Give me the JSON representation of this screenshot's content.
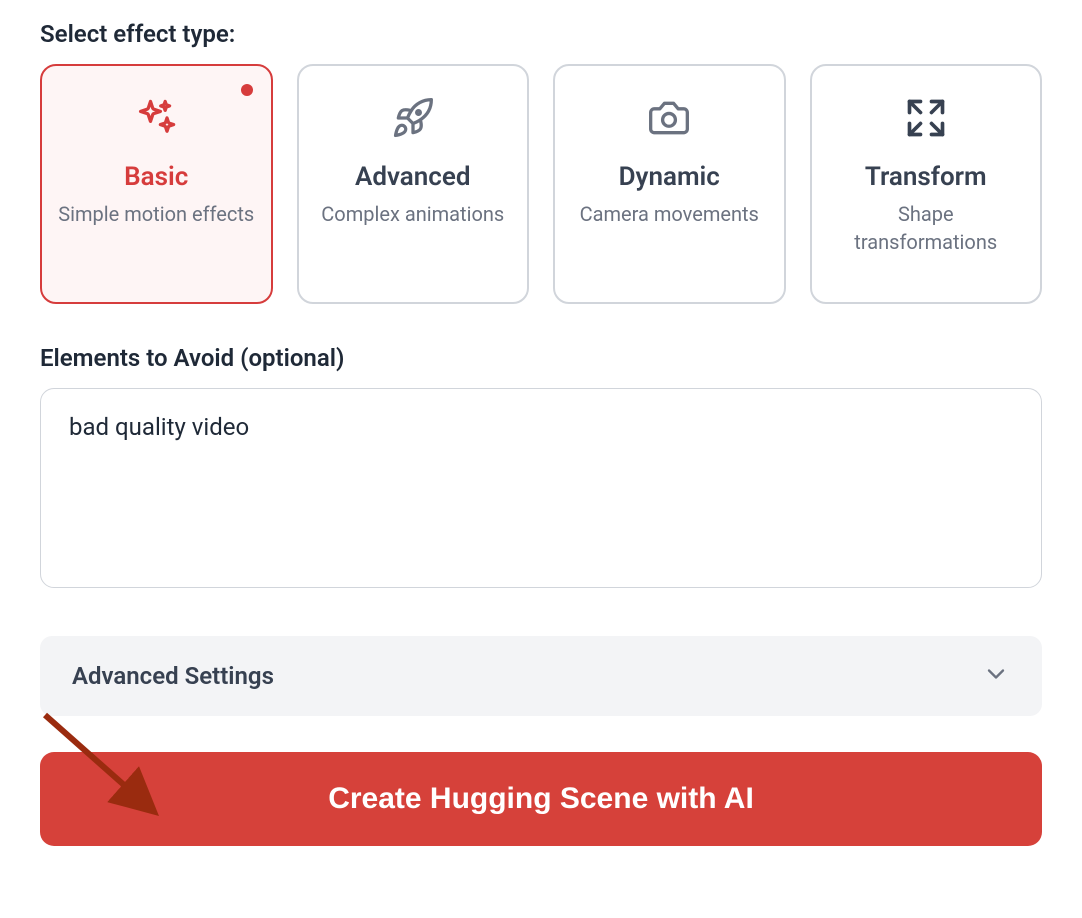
{
  "labels": {
    "effect_type": "Select effect type:",
    "elements_avoid": "Elements to Avoid (optional)",
    "advanced_settings": "Advanced Settings",
    "create_button": "Create Hugging Scene with AI"
  },
  "effect_types": [
    {
      "id": "basic",
      "title": "Basic",
      "desc": "Simple motion effects",
      "selected": true
    },
    {
      "id": "advanced",
      "title": "Advanced",
      "desc": "Complex animations",
      "selected": false
    },
    {
      "id": "dynamic",
      "title": "Dynamic",
      "desc": "Camera movements",
      "selected": false
    },
    {
      "id": "transform",
      "title": "Transform",
      "desc": "Shape transformations",
      "selected": false
    }
  ],
  "avoid_value": "bad quality video",
  "colors": {
    "accent": "#d63c3c",
    "button": "#d6413a"
  }
}
